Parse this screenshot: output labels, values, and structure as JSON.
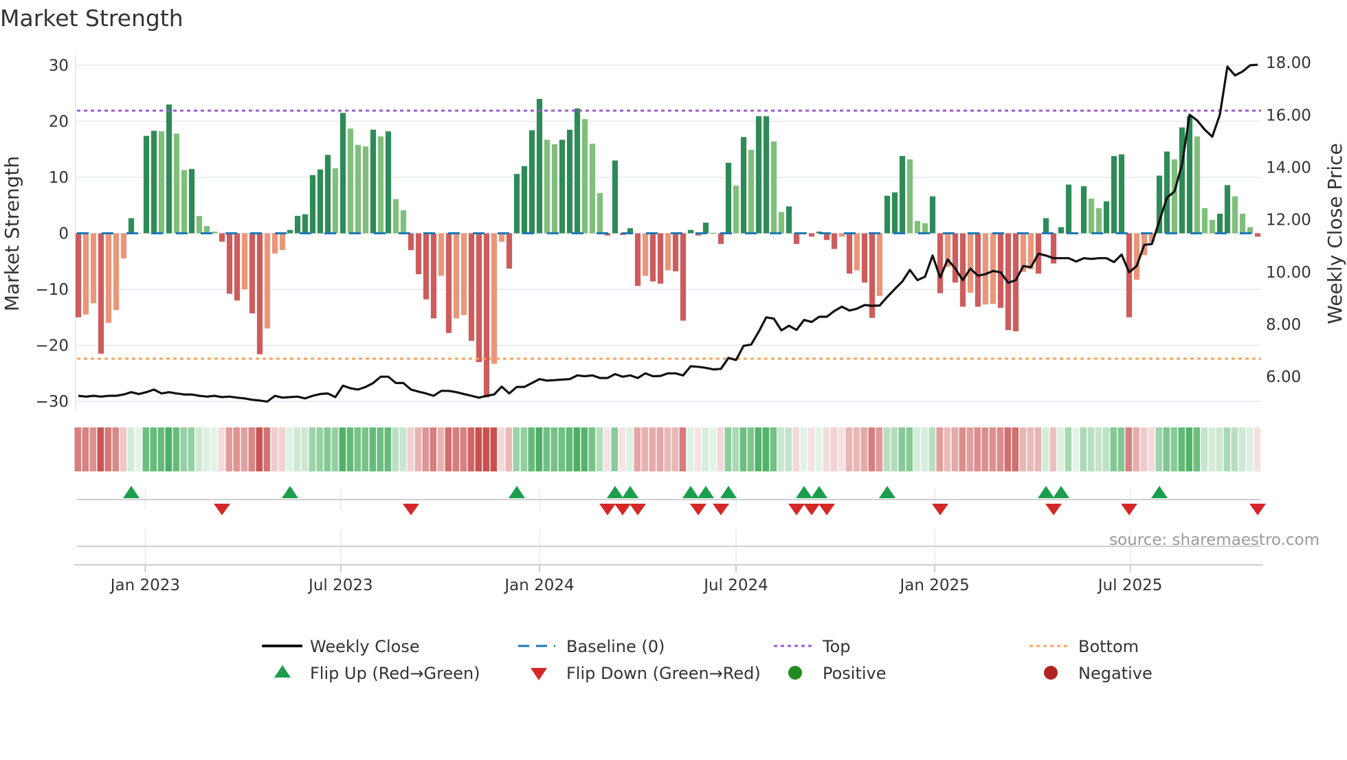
{
  "title": "Market Strength",
  "source": "source: sharemaestro.com",
  "axes": {
    "left_label": "Market Strength",
    "right_label": "Weekly Close Price",
    "left_ticks": [
      30,
      20,
      10,
      0,
      -10,
      -20,
      -30
    ],
    "left_tick_labels": [
      "30",
      "20",
      "10",
      "0",
      "−10",
      "−20",
      "−30"
    ],
    "right_ticks": [
      18,
      16,
      14,
      12,
      10,
      8,
      6
    ],
    "right_tick_labels": [
      "18.00",
      "16.00",
      "14.00",
      "12.00",
      "10.00",
      "8.00",
      "6.00"
    ],
    "x_ticks": [
      {
        "date": "2023-01-01",
        "label": "Jan 2023"
      },
      {
        "date": "2023-07-01",
        "label": "Jul 2023"
      },
      {
        "date": "2024-01-01",
        "label": "Jan 2024"
      },
      {
        "date": "2024-07-01",
        "label": "Jul 2024"
      },
      {
        "date": "2025-01-01",
        "label": "Jan 2025"
      },
      {
        "date": "2025-07-01",
        "label": "Jul 2025"
      }
    ]
  },
  "legend": {
    "weekly_close": "Weekly Close",
    "baseline": "Baseline (0)",
    "top": "Top",
    "bottom": "Bottom",
    "flip_up": "Flip Up (Red→Green)",
    "flip_down": "Flip Down (Green→Red)",
    "positive": "Positive",
    "negative": "Negative"
  },
  "colors": {
    "pos_strong": "#2e8b57",
    "pos_weak": "#7fbf7b",
    "neg_strong": "#cd5c5c",
    "neg_weak": "#e9967a",
    "close": "#111111",
    "baseline": "#1f77b4",
    "top": "#9b59d6",
    "bottom": "#f4a460",
    "flip_up": "#1a9e4b",
    "flip_down": "#d62728",
    "positive_dot": "#228b22",
    "negative_dot": "#b22222"
  },
  "chart_data": {
    "type": "bar",
    "title": "Market Strength",
    "xlabel": "",
    "ylabel": "Market Strength",
    "y2label": "Weekly Close Price",
    "ylim": [
      -31.5,
      31.5
    ],
    "y2lim": [
      4.74,
      18.22
    ],
    "start_date": "2022-10-31",
    "interval_days": 7,
    "top": 21.9,
    "bottom": -22.4,
    "baseline": 0,
    "strength": [
      -15,
      -14.5,
      -12.5,
      -21.5,
      -16,
      -13.7,
      -4.5,
      2.7,
      0,
      17.4,
      18.3,
      18.2,
      23,
      17.8,
      11.3,
      11.5,
      3.1,
      1.3,
      0.3,
      -1.5,
      -10.8,
      -12,
      -10,
      -14.3,
      -21.6,
      -17,
      -3.6,
      -3,
      0.6,
      3.1,
      3.4,
      10.4,
      11.4,
      14,
      11.6,
      21.5,
      18.7,
      15.8,
      15.5,
      18.5,
      17.3,
      18.2,
      6.1,
      4.1,
      -3,
      -7.3,
      -11.8,
      -15.2,
      -7.6,
      -17.8,
      -15.2,
      -14.6,
      -19.2,
      -23,
      -29.3,
      -23.3,
      -1.5,
      -6.3,
      10.6,
      12,
      18.4,
      24,
      16.7,
      15.9,
      16.7,
      18.5,
      22.3,
      20.4,
      16,
      7.2,
      -0.4,
      13,
      -0.3,
      0.9,
      -9.4,
      -7.6,
      -8.6,
      -9,
      -6.6,
      -6.8,
      -15.6,
      0.6,
      -0.4,
      1.9,
      0.1,
      -1.9,
      12.6,
      8.5,
      17.2,
      14.9,
      20.9,
      20.9,
      16.4,
      3.8,
      4.8,
      -1.9,
      0.2,
      -0.6,
      0.3,
      -1.2,
      -2.8,
      -0.6,
      -7.2,
      -6.6,
      -8.8,
      -15.1,
      -11.2,
      6.7,
      7.3,
      13.8,
      13.2,
      2.2,
      1.8,
      6.6,
      -10.7,
      -6,
      -8.8,
      -13.1,
      -10.6,
      -13.1,
      -12.7,
      -12.6,
      -13.3,
      -17.3,
      -17.5,
      -6.9,
      -6.4,
      -7.2,
      2.7,
      -5.4,
      1.1,
      8.7,
      0,
      8.4,
      6.2,
      4.5,
      5.7,
      13.8,
      14.1,
      -15,
      -8.3,
      -3.9,
      -1.6,
      10.3,
      14.6,
      13.2,
      18.9,
      20.9,
      17.3,
      4.5,
      2.4,
      3.5,
      8.6,
      6.6,
      3.5,
      1.1,
      -0.6
    ],
    "close": [
      5.27,
      5.24,
      5.27,
      5.24,
      5.27,
      5.27,
      5.32,
      5.41,
      5.34,
      5.41,
      5.51,
      5.36,
      5.41,
      5.36,
      5.32,
      5.32,
      5.27,
      5.24,
      5.27,
      5.22,
      5.24,
      5.2,
      5.17,
      5.12,
      5.09,
      5.05,
      5.27,
      5.2,
      5.22,
      5.24,
      5.17,
      5.27,
      5.34,
      5.36,
      5.22,
      5.66,
      5.56,
      5.51,
      5.61,
      5.76,
      6.0,
      6.0,
      5.76,
      5.76,
      5.51,
      5.43,
      5.36,
      5.27,
      5.46,
      5.46,
      5.41,
      5.34,
      5.27,
      5.2,
      5.27,
      5.32,
      5.62,
      5.36,
      5.61,
      5.61,
      5.76,
      5.91,
      5.85,
      5.87,
      5.89,
      5.91,
      6.05,
      6.02,
      6.05,
      5.95,
      5.95,
      6.1,
      6.0,
      6.05,
      5.95,
      6.13,
      6.02,
      6.03,
      6.13,
      6.13,
      6.05,
      6.4,
      6.38,
      6.34,
      6.28,
      6.3,
      6.72,
      6.64,
      7.18,
      7.23,
      7.72,
      8.27,
      8.22,
      7.77,
      7.95,
      7.79,
      8.17,
      8.09,
      8.29,
      8.29,
      8.51,
      8.68,
      8.53,
      8.6,
      8.74,
      8.71,
      8.72,
      9.05,
      9.35,
      9.64,
      10.08,
      9.69,
      9.82,
      10.63,
      9.79,
      10.48,
      10.13,
      9.69,
      10.13,
      9.86,
      9.92,
      10.04,
      9.99,
      9.59,
      9.69,
      10.23,
      10.18,
      10.7,
      10.63,
      10.53,
      10.53,
      10.53,
      10.4,
      10.53,
      10.5,
      10.53,
      10.53,
      10.38,
      10.67,
      9.99,
      10.23,
      11.04,
      11.07,
      11.95,
      12.84,
      13.08,
      14.12,
      16.01,
      15.79,
      15.44,
      15.17,
      16.01,
      17.85,
      17.51,
      17.66,
      17.9,
      17.92
    ]
  }
}
